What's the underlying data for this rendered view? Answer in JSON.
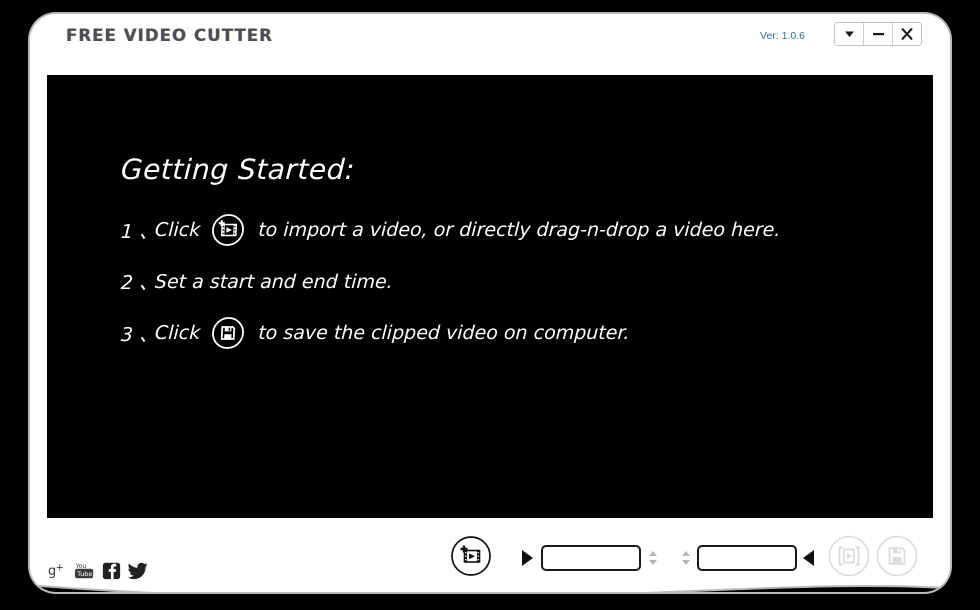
{
  "window": {
    "title": "FREE VIDEO CUTTER",
    "version_label": "Ver: 1.0.6",
    "buttons": {
      "menu": "chevron-down",
      "minimize": "minimize",
      "close": "close"
    }
  },
  "stage": {
    "background_color": "#000000",
    "heading": "Getting Started:",
    "steps": [
      {
        "number": "1 、",
        "text_before": "Click",
        "icon": "import-video-icon",
        "text_after": "to import a video, or directly drag-n-drop a video here."
      },
      {
        "number": "2 、",
        "text_before": "Set a start and end time.",
        "icon": "",
        "text_after": ""
      },
      {
        "number": "3 、",
        "text_before": "Click",
        "icon": "save-floppy-icon",
        "text_after": "to save the clipped video on computer."
      }
    ]
  },
  "controlbar": {
    "social": [
      {
        "name": "google-plus-icon",
        "label": "g+"
      },
      {
        "name": "youtube-icon",
        "label": "You Tube"
      },
      {
        "name": "facebook-icon",
        "label": "f"
      },
      {
        "name": "twitter-icon",
        "label": "twitter bird"
      }
    ],
    "add_video_button": "add-video-icon",
    "start_time": {
      "value": "",
      "placeholder": ""
    },
    "end_time": {
      "value": "",
      "placeholder": ""
    },
    "preview_clip_button": "preview-clip-icon",
    "save_button": "save-floppy-icon",
    "disabled_color": "#d9d9d9",
    "enabled_color": "#111111"
  }
}
